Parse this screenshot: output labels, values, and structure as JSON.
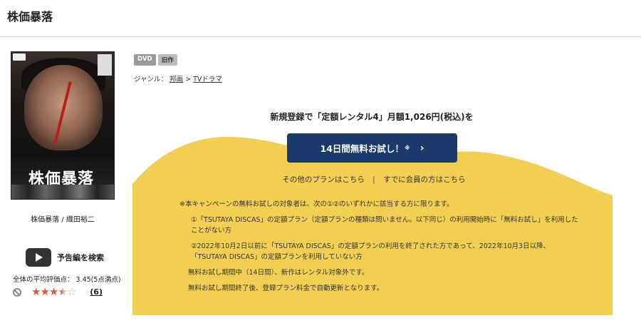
{
  "page": {
    "title": "株価暴落"
  },
  "poster": {
    "alt_title": "株価暴落",
    "caption": "株価暴落 / 織田裕二"
  },
  "trailer": {
    "label": "予告編を検索",
    "icon": "play-icon"
  },
  "rating": {
    "label": "全体の平均評価点： 3.45(5点満点)",
    "score": 3.45,
    "max": 5,
    "stars": [
      "on",
      "on",
      "on",
      "half",
      "off"
    ],
    "count": "(6)",
    "star_color": "#e0533f"
  },
  "tags": [
    "DVD",
    "旧作"
  ],
  "genre": {
    "prefix": "ジャンル：",
    "items": [
      "邦画",
      "TVドラマ"
    ],
    "separator": ">"
  },
  "campaign": {
    "signup_text": "新規登録で「定額レンタル4」月額1,026円(税込)を",
    "cta_label": "14日間無料お試し！",
    "cta_suffix": "※",
    "other_plans": "その他のプランはこちら",
    "separator": "|",
    "members": "すでに会員の方はこちら",
    "accent_color": "#1a3a6b",
    "bg_color": "#f2cf52"
  },
  "notes": {
    "intro": "※本キャンペーンの無料お試しの対象者は、次の①②のいずれかに該当する方に限ります。",
    "item1": "①「TSUTAYA DISCAS」の定額プラン（定額プランの種類は問いません。以下同じ）の利用開始時に「無料お試し」を利用したことがない方",
    "item2": "②2022年10月2日以前に「TSUTAYA DISCAS」の定額プランの利用を終了された方であって、2022年10月3日以降、「TSUTAYA DISCAS」の定額プランを利用していない方",
    "note1": "無料お試し期間中（14日間）、新作はレンタル対象外です。",
    "note2": "無料お試し期間終了後、登録プラン料金で自動更新となります。"
  }
}
